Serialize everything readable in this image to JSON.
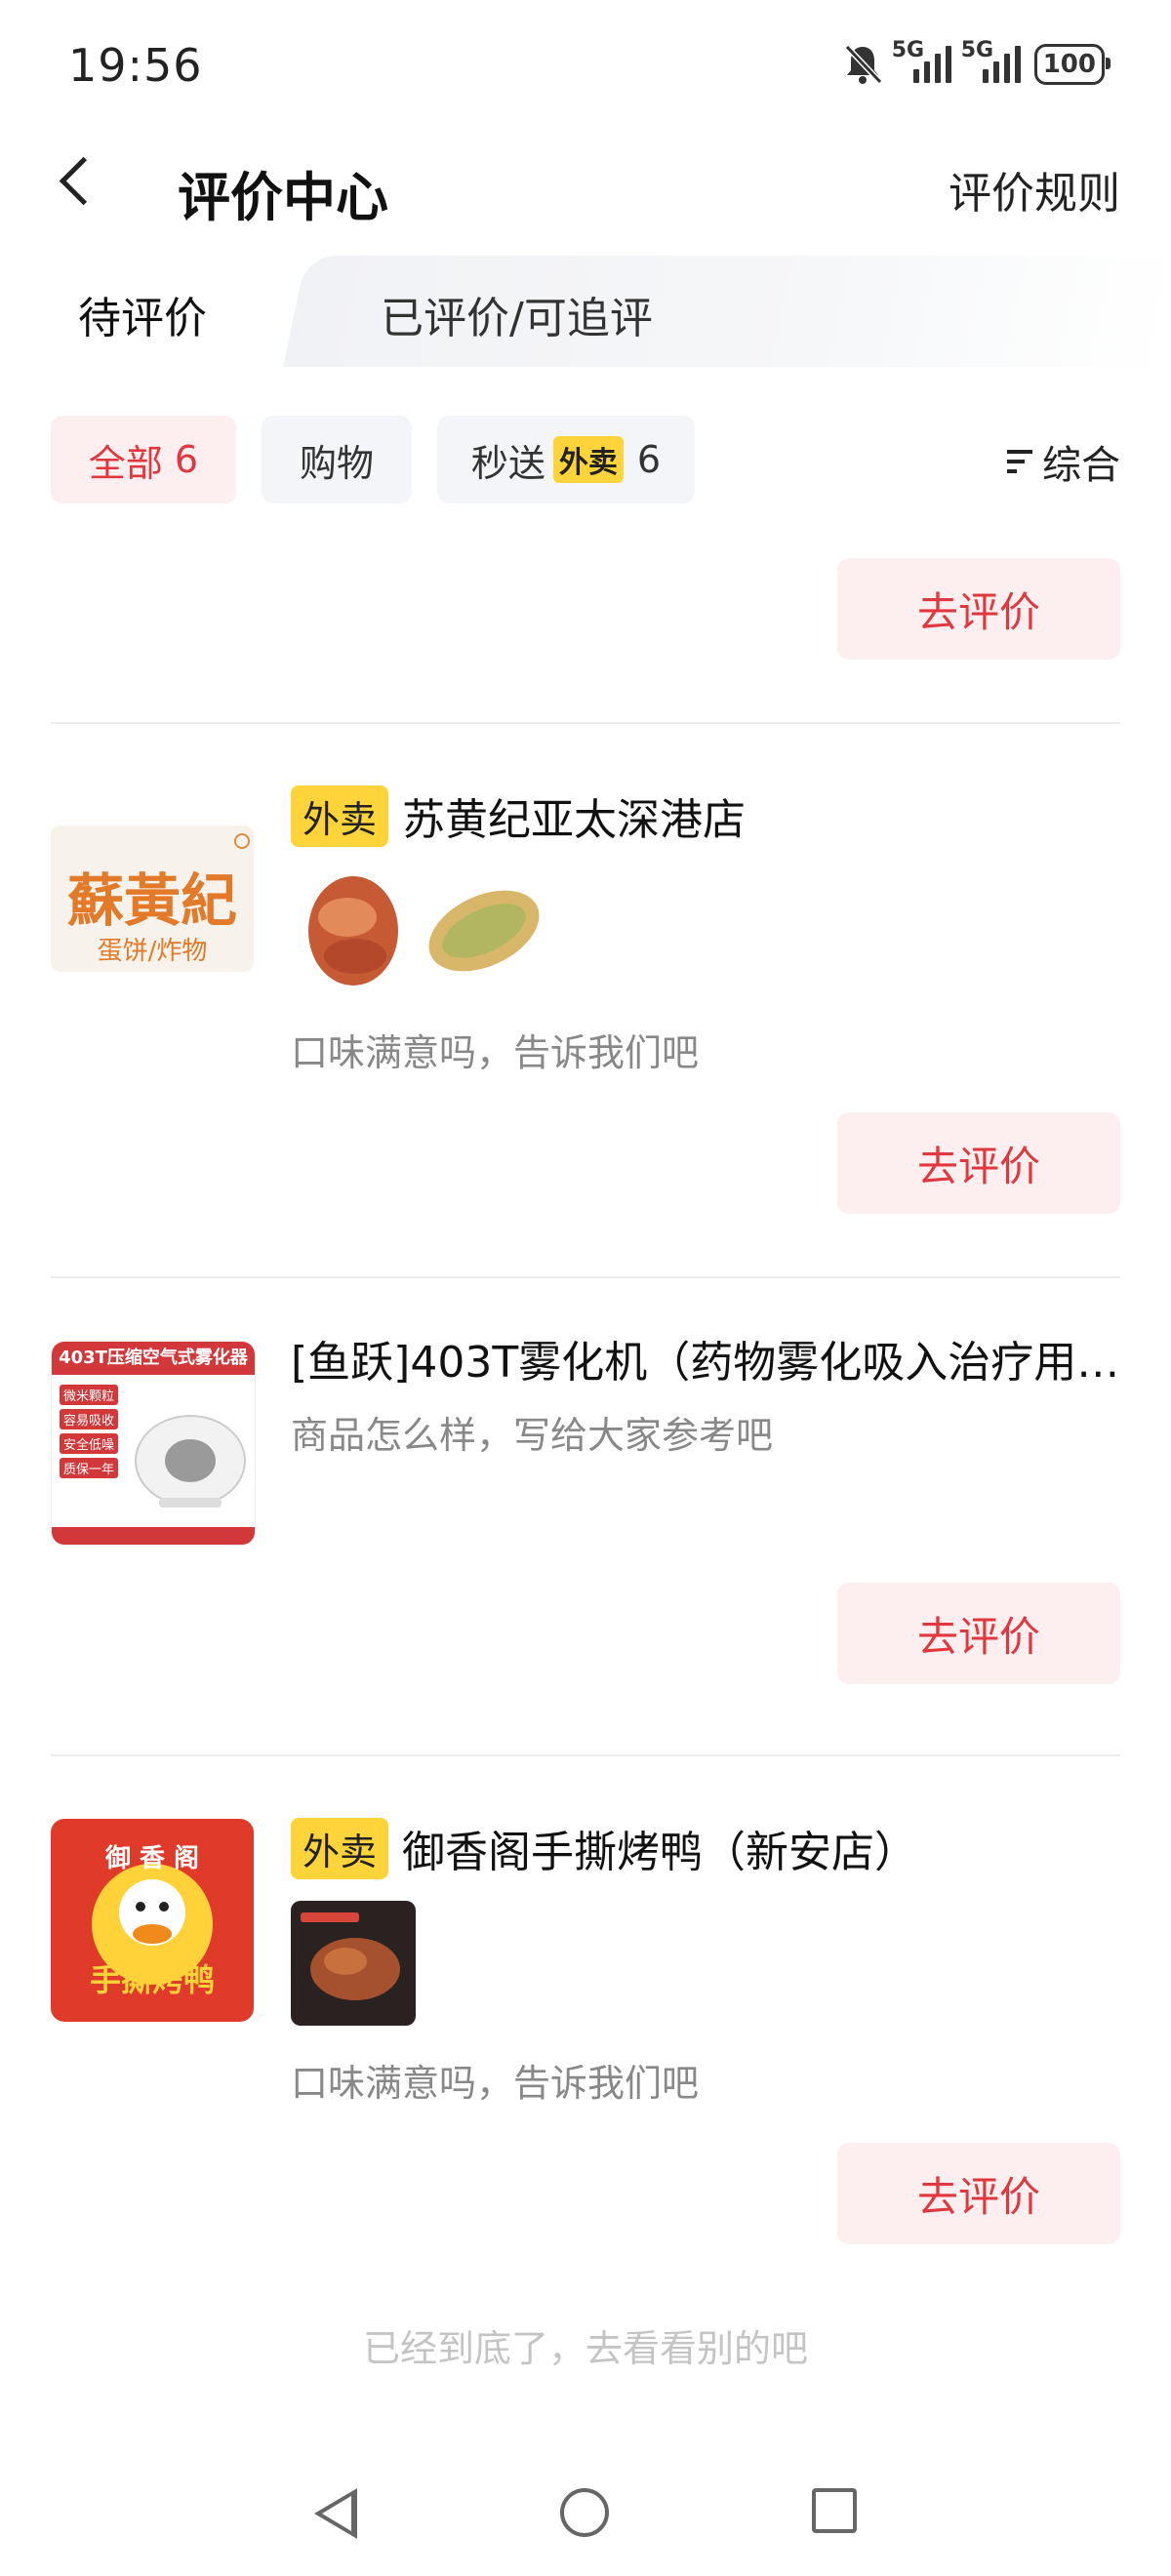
{
  "status_bar": {
    "time": "19:56",
    "signal1": "5G",
    "signal2": "5G",
    "battery": "100",
    "icons": [
      "bell-muted-icon",
      "signal-icon",
      "signal-icon",
      "battery-icon"
    ]
  },
  "header": {
    "title": "评价中心",
    "rules_label": "评价规则"
  },
  "tabs": {
    "pending": "待评价",
    "reviewed": "已评价/可追评"
  },
  "filters": {
    "all_label": "全部",
    "all_count": "6",
    "shopping_label": "购物",
    "fast_label": "秒送",
    "fast_tag": "外卖",
    "fast_count": "6",
    "sort_label": "综合"
  },
  "button_label": "去评价",
  "orders": [
    {
      "tag": "外卖",
      "store": "苏黄纪亚太深港店",
      "logo_text": "蘇黃紀",
      "logo_sub": "蛋饼/炸物",
      "prompt": "口味满意吗，告诉我们吧"
    },
    {
      "title": "[鱼跃]403T雾化机（药物雾化吸入治疗用…",
      "thumb_header": "403T压缩空气式雾化器",
      "thumb_features": [
        "微米颗粒",
        "容易吸收",
        "安全低噪",
        "质保一年"
      ],
      "prompt": "商品怎么样，写给大家参考吧"
    },
    {
      "tag": "外卖",
      "store": "御香阁手撕烤鸭（新安店）",
      "logo_top": "御 香 阁",
      "logo_bottom": "手撕烤鸭",
      "prompt": "口味满意吗，告诉我们吧"
    }
  ],
  "footer_text": "已经到底了，去看看别的吧",
  "colors": {
    "accent": "#e0383e",
    "accent_bg": "#fdeef0",
    "tag_yellow": "#ffd43a"
  }
}
